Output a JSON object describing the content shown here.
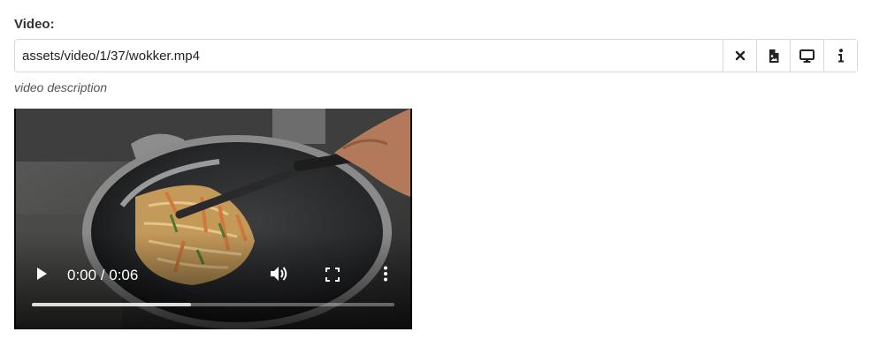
{
  "field": {
    "label": "Video:",
    "value": "assets/video/1/37/wokker.mp4",
    "description": "video description",
    "buttons": {
      "clear": "close-icon",
      "browse": "file-image-icon",
      "preview": "desktop-icon",
      "info": "info-icon"
    }
  },
  "video": {
    "time": "0:00 / 0:06",
    "buffered_fraction": 0.44
  }
}
